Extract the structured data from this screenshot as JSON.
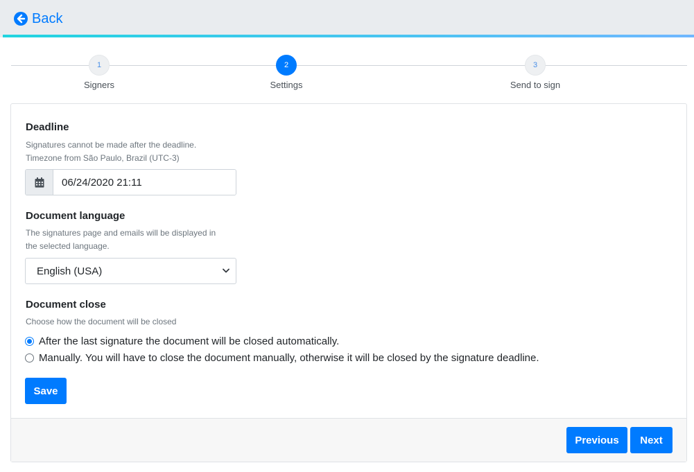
{
  "header": {
    "back_label": "Back"
  },
  "stepper": {
    "steps": [
      {
        "number": "1",
        "label": "Signers",
        "state": "inactive"
      },
      {
        "number": "2",
        "label": "Settings",
        "state": "active"
      },
      {
        "number": "3",
        "label": "Send to sign",
        "state": "inactive"
      }
    ]
  },
  "deadline": {
    "title": "Deadline",
    "help_line1": "Signatures cannot be made after the deadline.",
    "help_line2": "Timezone from São Paulo, Brazil (UTC-3)",
    "value": "06/24/2020 21:11",
    "icon": "calendar-icon"
  },
  "language": {
    "title": "Document language",
    "help_line1": "The signatures page and emails will be displayed in",
    "help_line2": "the selected language.",
    "selected": "English (USA)"
  },
  "close": {
    "title": "Document close",
    "help": "Choose how the document will be closed",
    "options": [
      {
        "label": "After the last signature the document will be closed automatically.",
        "checked": true
      },
      {
        "label": "Manually. You will have to close the document manually, otherwise it will be closed by the signature deadline.",
        "checked": false
      }
    ]
  },
  "actions": {
    "save_label": "Save",
    "previous_label": "Previous",
    "next_label": "Next"
  },
  "colors": {
    "primary": "#007bff",
    "header_bg": "#e9ecef",
    "accent_gradient_start": "#21d4e0"
  }
}
